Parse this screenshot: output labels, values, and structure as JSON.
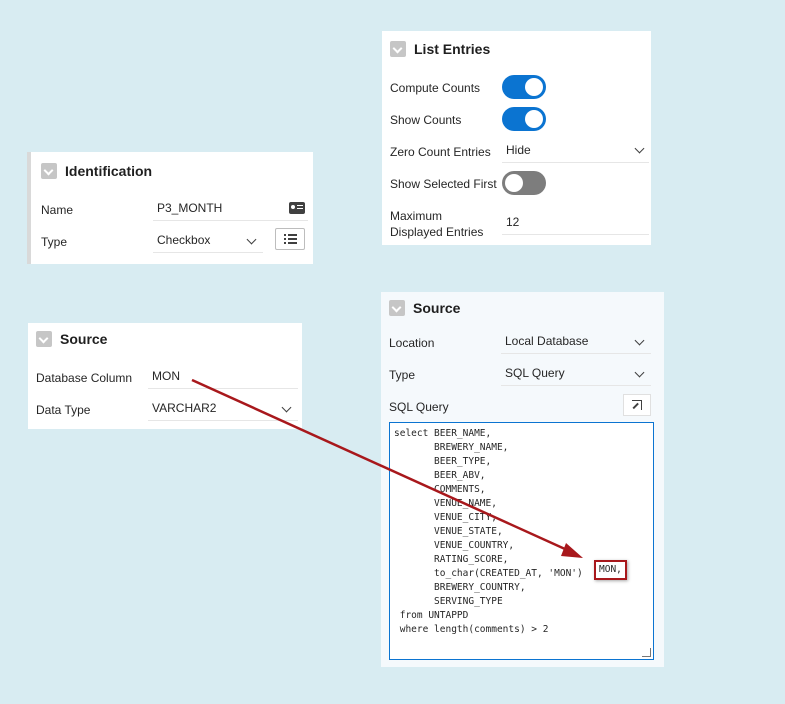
{
  "identification": {
    "title": "Identification",
    "name_label": "Name",
    "name_value": "P3_MONTH",
    "type_label": "Type",
    "type_value": "Checkbox"
  },
  "source_left": {
    "title": "Source",
    "db_column_label": "Database Column",
    "db_column_value": "MON",
    "data_type_label": "Data Type",
    "data_type_value": "VARCHAR2"
  },
  "list_entries": {
    "title": "List Entries",
    "compute_counts_label": "Compute Counts",
    "compute_counts_on": true,
    "show_counts_label": "Show Counts",
    "show_counts_on": true,
    "zero_count_label": "Zero Count Entries",
    "zero_count_value": "Hide",
    "show_selected_first_label": "Show Selected First",
    "show_selected_first_on": false,
    "max_displayed_label_line1": "Maximum",
    "max_displayed_label_line2": "Displayed Entries",
    "max_displayed_value": "12"
  },
  "source_right": {
    "title": "Source",
    "location_label": "Location",
    "location_value": "Local Database",
    "type_label": "Type",
    "type_value": "SQL Query",
    "sql_query_label": "SQL Query",
    "sql_query_text": "select BEER_NAME,\n       BREWERY_NAME,\n       BEER_TYPE,\n       BEER_ABV,\n       COMMENTS,\n       VENUE_NAME,\n       VENUE_CITY,\n       VENUE_STATE,\n       VENUE_COUNTRY,\n       RATING_SCORE,\n       to_char(CREATED_AT, 'MON')\n       BREWERY_COUNTRY,\n       SERVING_TYPE\n from UNTAPPD\n where length(comments) > 2",
    "highlighted_alias": "MON,"
  },
  "colors": {
    "background": "#d8ecf2",
    "toggle_on": "#0b74d1",
    "toggle_off": "#7d7d7d",
    "arrow": "#a8181c"
  },
  "icons": {
    "name_field_icon": "id-card-icon",
    "type_list_icon": "list-icon",
    "expand_editor_icon": "expand-icon"
  }
}
